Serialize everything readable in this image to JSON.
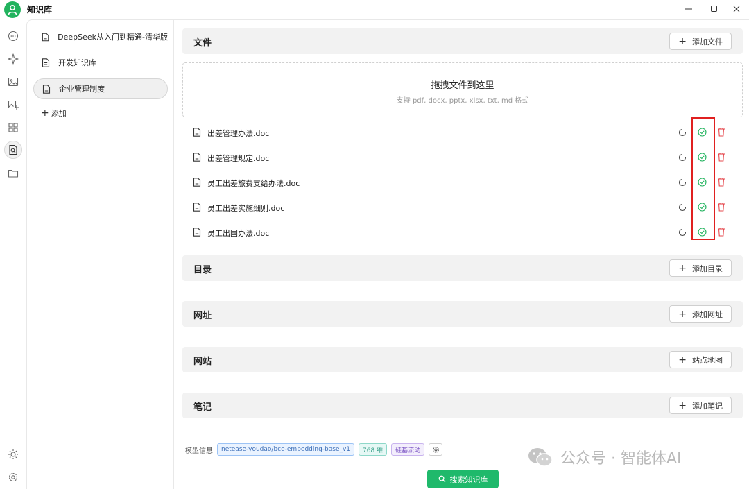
{
  "window": {
    "title": "知识库",
    "controls": {
      "minimize_icon": "minimize-icon",
      "maximize_icon": "maximize-icon",
      "close_icon": "close-icon"
    }
  },
  "rail": {
    "icons": [
      "chat-icon",
      "sparkle-icon",
      "image-icon",
      "image-edit-icon",
      "apps-grid-icon",
      "knowledge-search-icon",
      "folder-icon"
    ],
    "bottom_icons": [
      "sun-icon",
      "settings-gear-icon"
    ],
    "active_index": 5
  },
  "kb_list": {
    "items": [
      {
        "label": "DeepSeek从入门到精通-清华版"
      },
      {
        "label": "开发知识库"
      },
      {
        "label": "企业管理制度"
      }
    ],
    "active_index": 2,
    "add_label": "添加"
  },
  "sections": {
    "files": {
      "title": "文件",
      "button": "添加文件"
    },
    "directory": {
      "title": "目录",
      "button": "添加目录"
    },
    "url": {
      "title": "网址",
      "button": "添加网址"
    },
    "website": {
      "title": "网站",
      "button": "站点地图"
    },
    "notes": {
      "title": "笔记",
      "button": "添加笔记"
    }
  },
  "dropzone": {
    "title": "拖拽文件到这里",
    "subtitle": "支持 pdf, docx, pptx, xlsx, txt, md 格式"
  },
  "files": [
    {
      "name": "出差管理办法.doc"
    },
    {
      "name": "出差管理规定.doc"
    },
    {
      "name": "员工出差旅费支给办法.doc"
    },
    {
      "name": "员工出差实施细则.doc"
    },
    {
      "name": "员工出国办法.doc"
    }
  ],
  "footer": {
    "label": "模型信息",
    "model_tag": "netease-youdao/bce-embedding-base_v1",
    "dim_tag": "768 维",
    "provider_tag": "硅基流动",
    "search_button": "搜索知识库"
  },
  "watermark": {
    "text": "公众号 · 智能体AI"
  },
  "colors": {
    "accent_green": "#1fb96b",
    "status_green": "#22b35e",
    "delete_red": "#e5484d",
    "highlight_red": "#e02020"
  }
}
